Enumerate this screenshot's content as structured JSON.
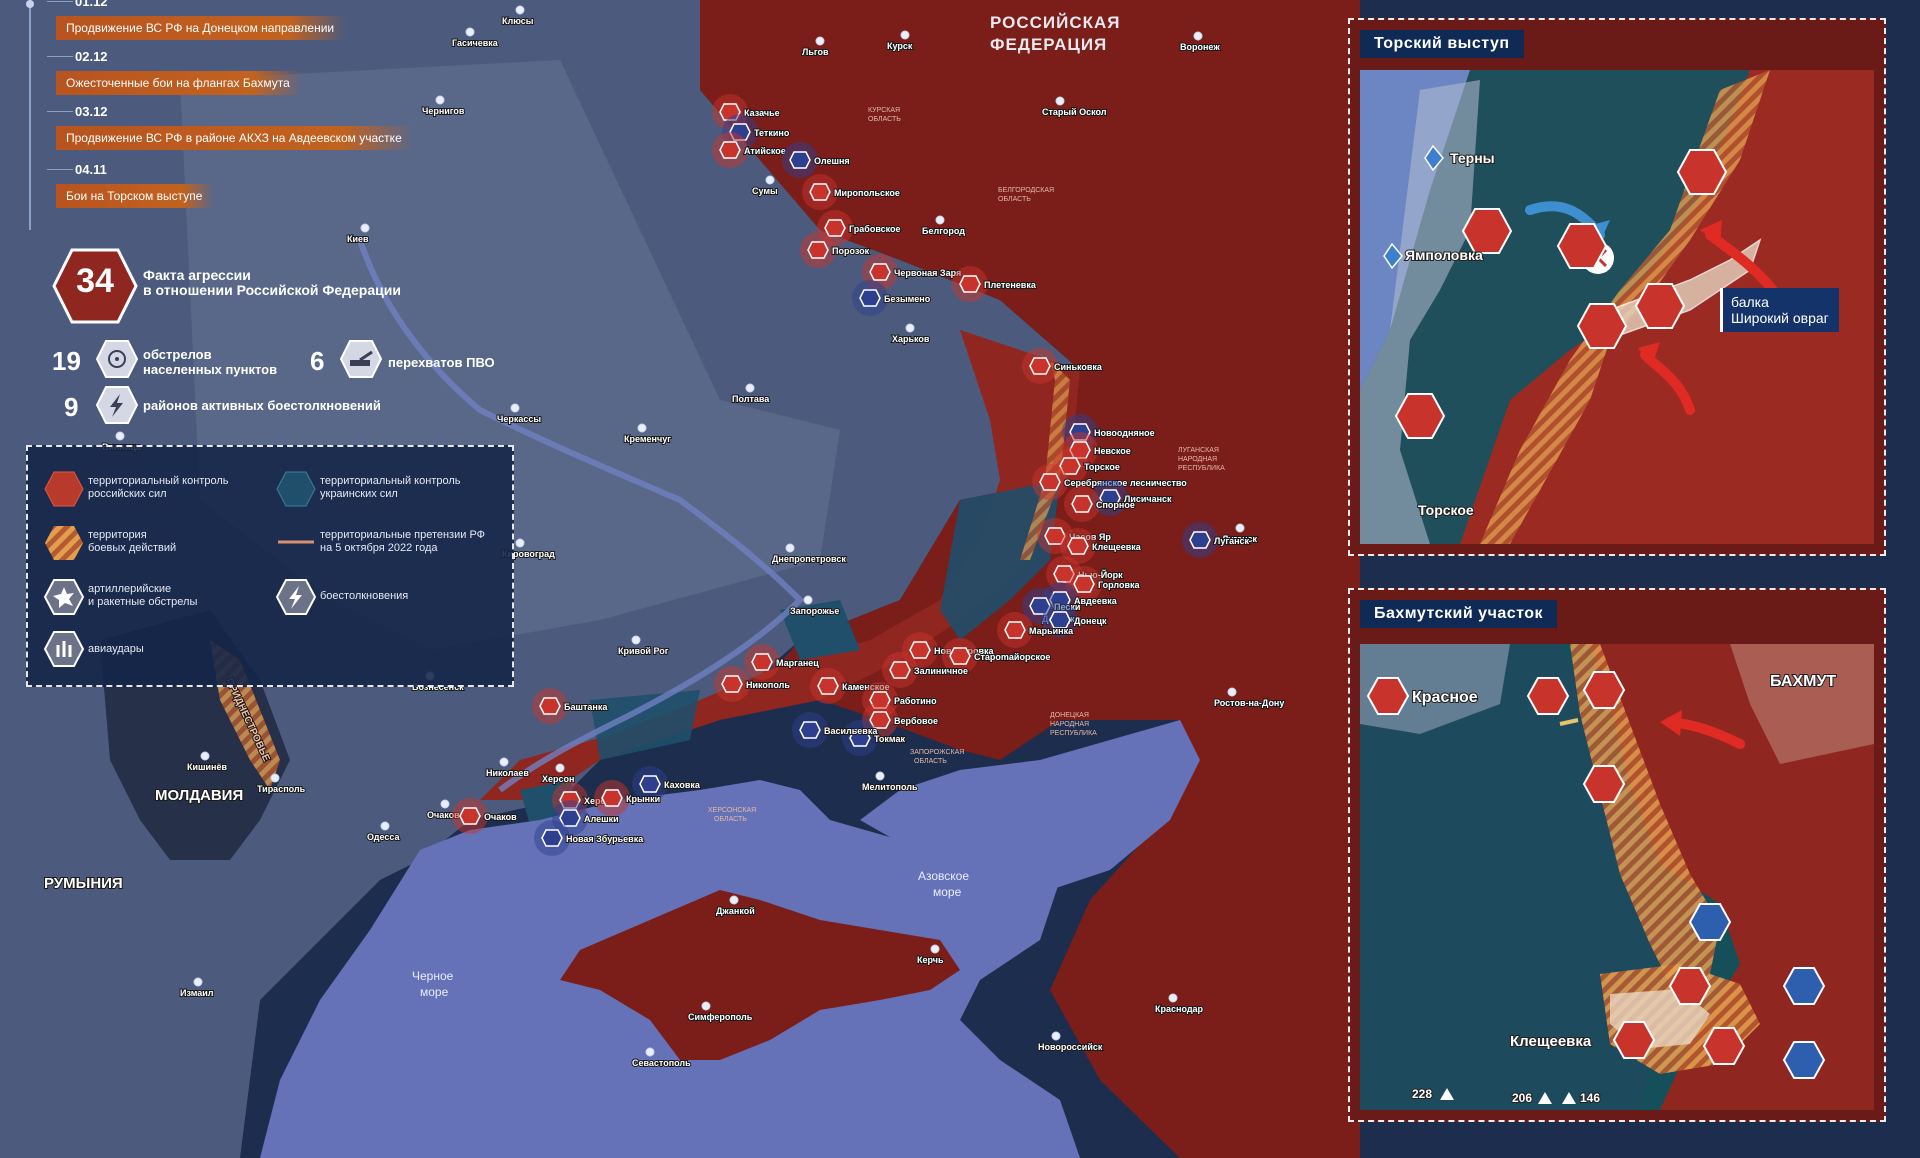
{
  "timeline": [
    {
      "date": "01.12",
      "text": "Продвижение ВС РФ на Донецком направлении"
    },
    {
      "date": "02.12",
      "text": "Ожесточенные бои на флангах Бахмута"
    },
    {
      "date": "03.12",
      "text": "Продвижение ВС РФ в районе АКХЗ на Авдеевском участке"
    },
    {
      "date": "04.11",
      "text": "Бои на Торском выступе"
    }
  ],
  "stats": {
    "total": "34",
    "total_label": "Факта агрессии\nв отношении Российской Федерации",
    "shelling_count": "19",
    "shelling_label": "обстрелов\nнаселенных пунктов",
    "pvo_count": "6",
    "pvo_label": "перехватов ПВО",
    "clash_count": "9",
    "clash_label": "районов активных боестолкновений"
  },
  "legend": {
    "ru_control": "территориальный контроль\nроссийских сил",
    "ua_control": "территориальный контроль\nукраинских сил",
    "combat": "территория\nбоевых действий",
    "claims": "территориальные претензии РФ\nна 5 октября 2022 года",
    "artillery": "артиллерийские\nи ракетные обстрелы",
    "clashes": "боестолкновения",
    "airstrikes": "авиаудары"
  },
  "colors": {
    "russia": "#7b1d18",
    "ru_control": "#8f2620",
    "ukraine_land": "#4c5b7d",
    "ua_control": "#1f4f6b",
    "sea": "#6672b8",
    "timeline_bar": "#c2621f",
    "event_red": "#c8332b",
    "event_blue": "#2e3f8f"
  },
  "map": {
    "countries": [
      "РОССИЙСКАЯ",
      "ФЕДЕРАЦИЯ",
      "МОЛДАВИЯ",
      "РУМЫНИЯ"
    ],
    "seas": [
      "Азовское",
      "море",
      "Черное",
      "море"
    ],
    "regions": [
      "КУРСКАЯ",
      "ОБЛАСТЬ",
      "БЕЛГОРОДСКАЯ",
      "ОБЛАСТЬ",
      "ЛУГАНСКАЯ",
      "НАРОДНАЯ",
      "РЕСПУБЛИКА",
      "ДОНЕЦКАЯ",
      "НАРОДНАЯ",
      "РЕСПУБЛИКА",
      "ЗАПОРОЖСКАЯ",
      "ОБЛАСТЬ",
      "ХЕРСОНСКАЯ",
      "ОБЛАСТЬ",
      "ПРИДНЕСТРОВЬЕ"
    ],
    "cities": [
      "Клюсы",
      "Гасичевка",
      "Чернигов",
      "Киев",
      "Сумы",
      "Льгов",
      "Курск",
      "Воронеж",
      "Старый Оскол",
      "Белгород",
      "Харьков",
      "Полтава",
      "Черкассы",
      "Кременчуг",
      "Кировоград",
      "Днепропетровск",
      "Запорожье",
      "Кривой Рог",
      "Николаев",
      "Херсон",
      "Одесса",
      "Измаил",
      "Кишинёв",
      "Тирасполь",
      "Вознесенск",
      "Очаков",
      "Мелитополь",
      "Джанкой",
      "Симферополь",
      "Севастополь",
      "Керчь",
      "Краснодар",
      "Новороссийск",
      "Ростов-на-Дону",
      "Луганск",
      "Донецк",
      "Винница"
    ],
    "events": [
      "Казачье",
      "Теткино",
      "Атийское",
      "Олешня",
      "Миропольское",
      "Грабовское",
      "Порозок",
      "Червоная Заря",
      "Безымено",
      "Плетеневка",
      "Синьковка",
      "Новоодняное",
      "Невское",
      "Торское",
      "Серебрянское лесничество",
      "Лисичанск",
      "Спорное",
      "Часов Яр",
      "Клещеевка",
      "Нью-Йорк",
      "Горловка",
      "Авдеевка",
      "Пески",
      "Донецк",
      "Марьинка",
      "Новодаровка",
      "Староmайорское",
      "Залиничное",
      "Каменское",
      "Работино",
      "Вербовое",
      "Токмак",
      "Васильевка",
      "Марганец",
      "Никополь",
      "Баштанка",
      "Херсон",
      "Каховка",
      "Крынки",
      "Алешки",
      "Новая Збурьевка",
      "Очаков",
      "Луганск"
    ]
  },
  "inset_torsk": {
    "title": "Торский выступ",
    "places": [
      "Терны",
      "Ямполовка",
      "Торское"
    ],
    "balka": "балка\nШирокий овраг"
  },
  "inset_bakhmut": {
    "title": "Бахмутский участок",
    "places": [
      "Красное",
      "БАХМУТ",
      "Клещеевка"
    ],
    "elevations": [
      "228",
      "206",
      "146"
    ]
  }
}
